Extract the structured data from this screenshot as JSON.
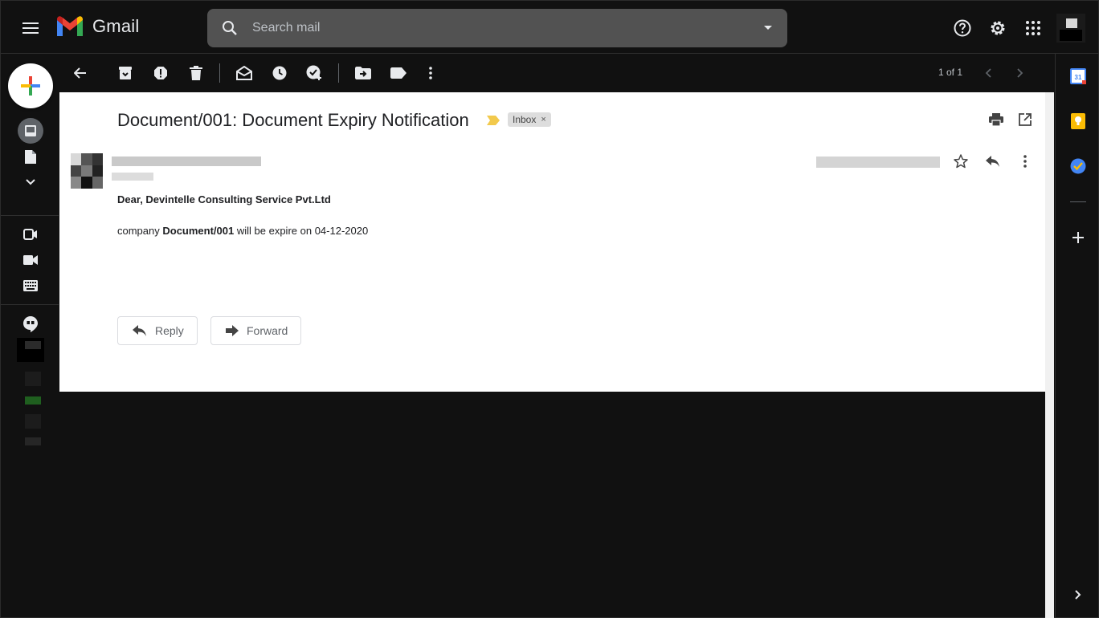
{
  "header": {
    "app_name": "Gmail",
    "search_placeholder": "Search mail"
  },
  "toolbar": {
    "pager_text": "1 of 1"
  },
  "email": {
    "subject": "Document/001: Document Expiry Notification",
    "label": "Inbox",
    "label_remove": "×",
    "greeting": "Dear, Devintelle Consulting Service Pvt.Ltd",
    "body_prefix": "company ",
    "body_bold": "Document/001",
    "body_suffix": " will be expire on 04-12-2020"
  },
  "actions": {
    "reply_label": "Reply",
    "forward_label": "Forward"
  },
  "side_panel": {
    "calendar_day": "31"
  },
  "colors": {
    "background": "#111111",
    "search_bg": "#525252",
    "important_marker": "#f2c94c",
    "label_chip": "#dddddd"
  }
}
